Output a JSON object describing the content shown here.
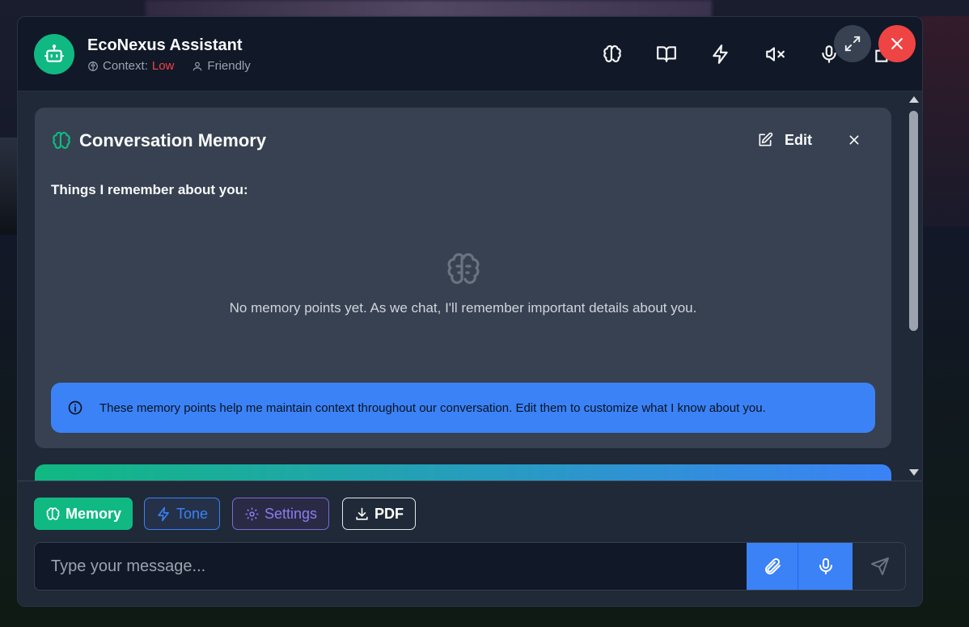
{
  "header": {
    "title": "EcoNexus Assistant",
    "context_label": "Context:",
    "context_value": "Low",
    "persona": "Friendly",
    "icons": [
      "brain-icon",
      "book-icon",
      "zap-icon",
      "volume-mute-icon",
      "mic-icon",
      "puzzle-icon"
    ]
  },
  "window_controls": {
    "expand": "expand-icon",
    "close": "close-icon"
  },
  "memory_panel": {
    "title": "Conversation Memory",
    "edit_label": "Edit",
    "remember_heading": "Things I remember about you:",
    "empty_text": "No memory points yet. As we chat, I'll remember important details about you.",
    "info_text": "These memory points help me maintain context throughout our conversation. Edit them to customize what I know about you."
  },
  "toolbar": {
    "memory_label": "Memory",
    "tone_label": "Tone",
    "settings_label": "Settings",
    "pdf_label": "PDF"
  },
  "composer": {
    "placeholder": "Type your message..."
  },
  "colors": {
    "accent_green": "#10b981",
    "accent_blue": "#3b82f6",
    "danger": "#ef4444",
    "surface": "#374151",
    "background": "#111827"
  }
}
